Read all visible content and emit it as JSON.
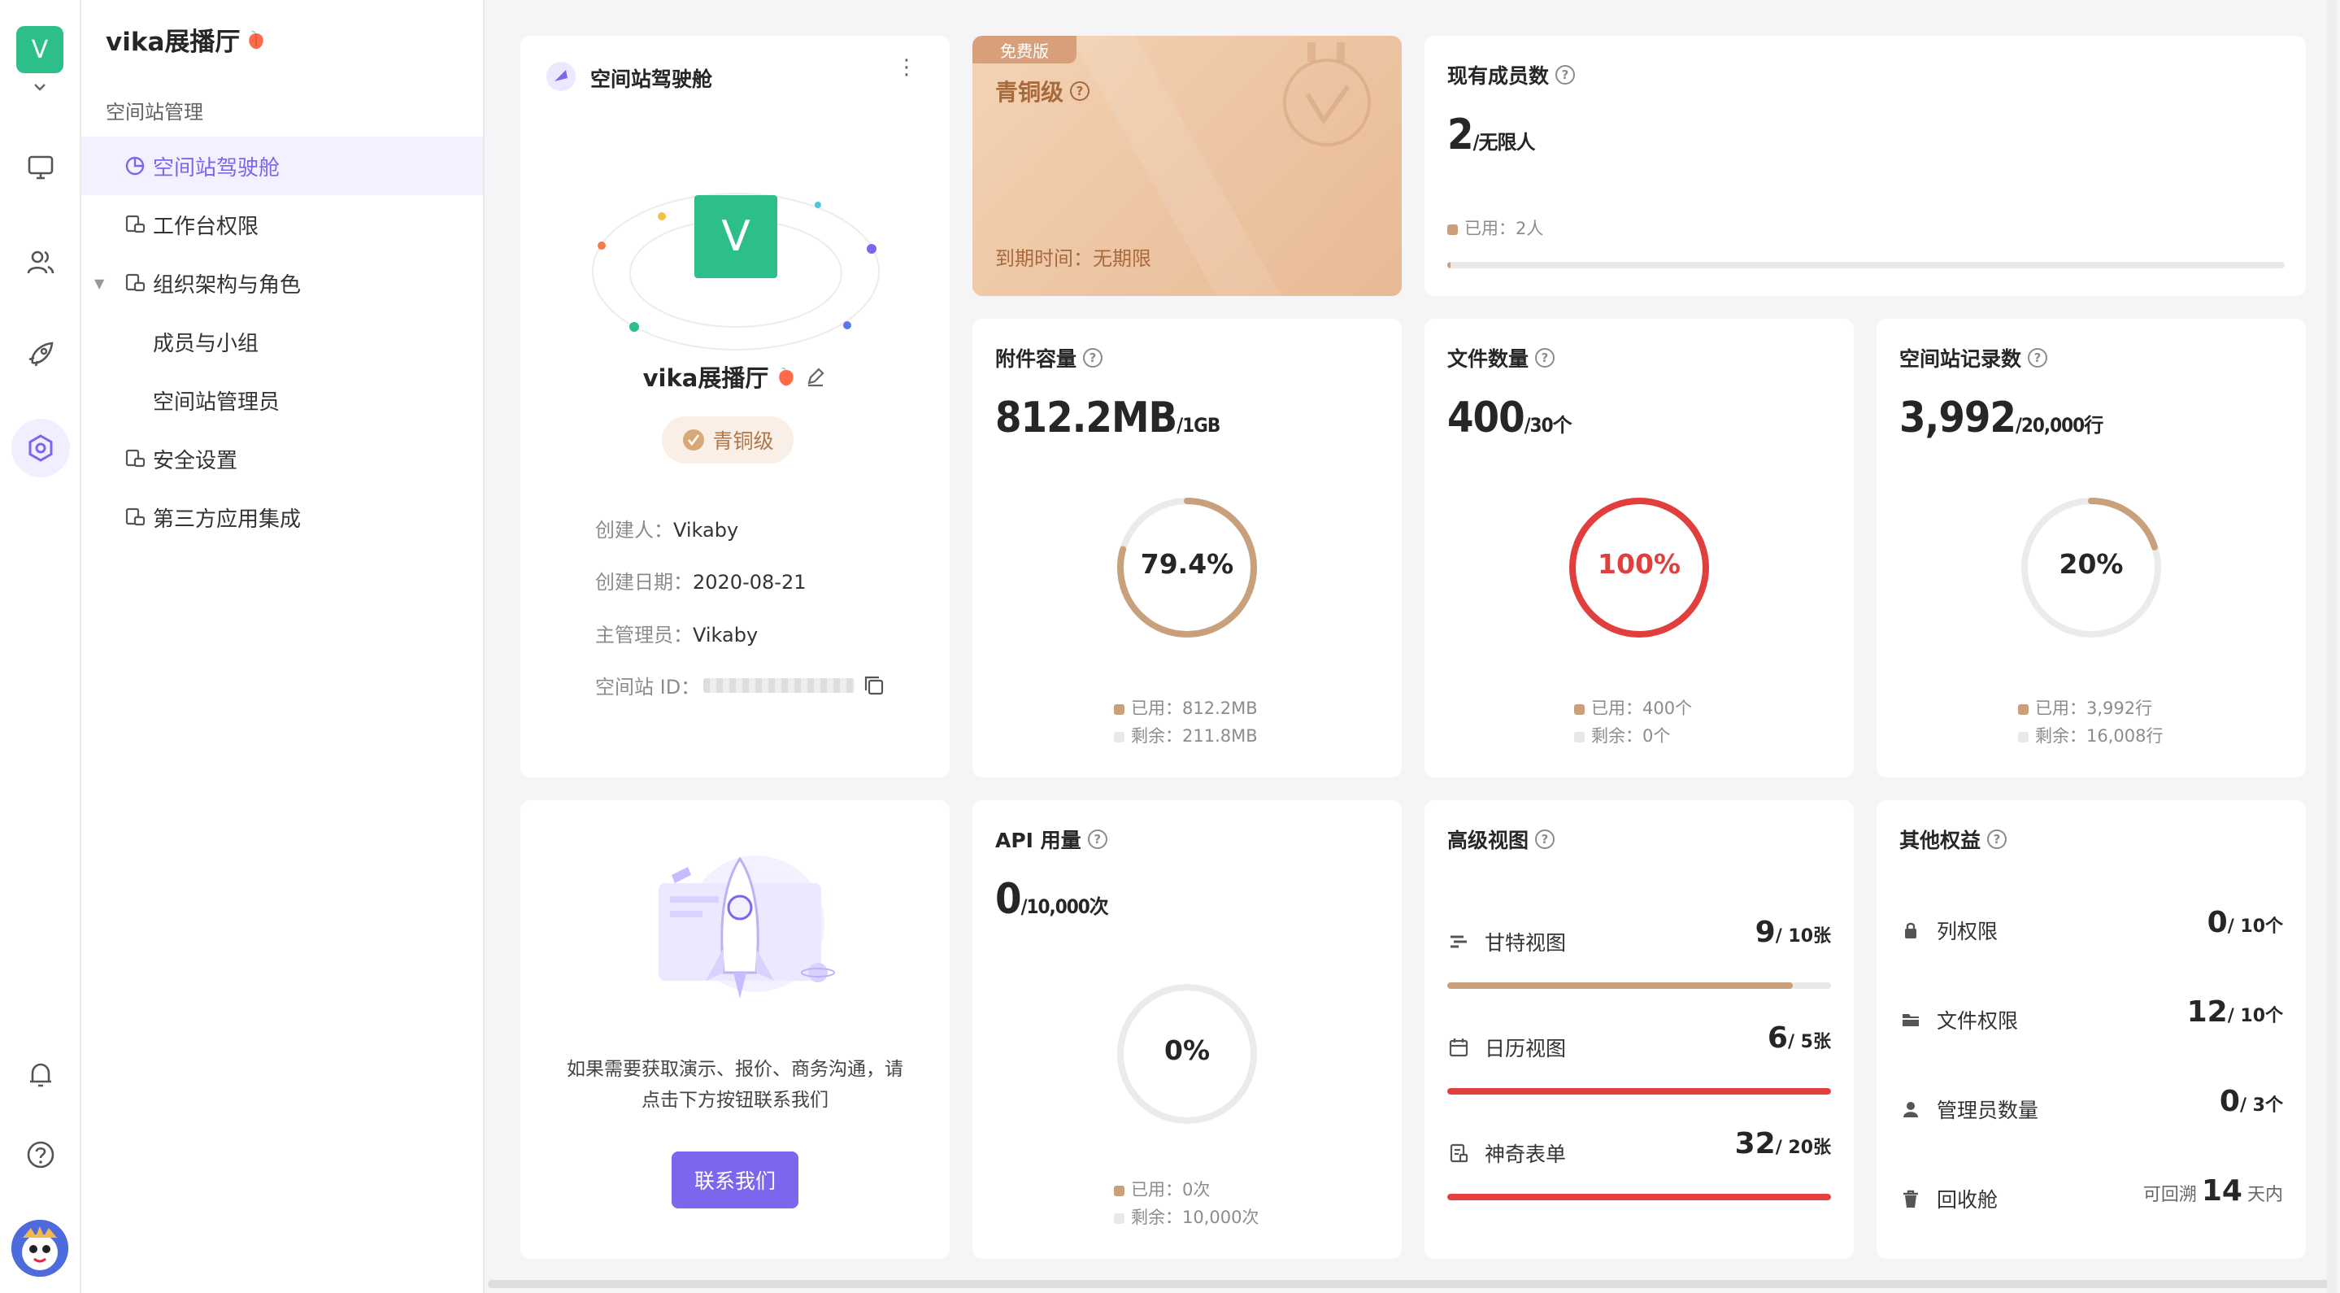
{
  "space": {
    "initial": "V",
    "name": "vika展播厅"
  },
  "sidebar": {
    "section": "空间站管理",
    "items": [
      {
        "label": "空间站驾驶舱"
      },
      {
        "label": "工作台权限"
      },
      {
        "label": "组织架构与角色"
      },
      {
        "label": "成员与小组"
      },
      {
        "label": "空间站管理员"
      },
      {
        "label": "安全设置"
      },
      {
        "label": "第三方应用集成"
      }
    ]
  },
  "cockpit": {
    "title": "空间站驾驶舱",
    "avatar_initial": "V",
    "name": "vika展播厅",
    "grade_badge": "青铜级",
    "creator_label": "创建人：",
    "creator": "Vikaby",
    "created_label": "创建日期：",
    "created": "2020-08-21",
    "admin_label": "主管理员：",
    "admin": "Vikaby",
    "id_label": "空间站 ID："
  },
  "plan": {
    "tag": "免费版",
    "grade": "青铜级",
    "expire": "到期时间：无期限"
  },
  "members": {
    "label": "现有成员数",
    "value": "2",
    "unit": "/无限人",
    "used": "已用：2人",
    "fraction": 0.002
  },
  "attachments": {
    "label": "附件容量",
    "value": "812.2MB",
    "unit": "/1GB",
    "percent": 79.4,
    "pct_label": "79.4%",
    "used": "已用：812.2MB",
    "remain": "剩余：211.8MB"
  },
  "files": {
    "label": "文件数量",
    "value": "400",
    "unit": "/30个",
    "percent": 100,
    "pct_label": "100%",
    "used": "已用：400个",
    "remain": "剩余：0个"
  },
  "records": {
    "label": "空间站记录数",
    "value": "3,992",
    "unit": "/20,000行",
    "percent": 20,
    "pct_label": "20%",
    "used": "已用：3,992行",
    "remain": "剩余：16,008行"
  },
  "contact": {
    "text1": "如果需要获取演示、报价、商务沟通，请",
    "text2": "点击下方按钮联系我们",
    "button": "联系我们"
  },
  "api": {
    "label": "API 用量",
    "value": "0",
    "unit": "/10,000次",
    "percent": 0,
    "pct_label": "0%",
    "used": "已用：0次",
    "remain": "剩余：10,000次"
  },
  "views": {
    "label": "高级视图",
    "items": [
      {
        "name": "甘特视图",
        "value": "9",
        "unit": "/ 10张",
        "fraction": 0.9
      },
      {
        "name": "日历视图",
        "value": "6",
        "unit": "/ 5张",
        "fraction": 1.0
      },
      {
        "name": "神奇表单",
        "value": "32",
        "unit": "/ 20张",
        "fraction": 1.0
      }
    ]
  },
  "benefits": {
    "label": "其他权益",
    "items": [
      {
        "name": "列权限",
        "value": "0",
        "unit": "/ 10个"
      },
      {
        "name": "文件权限",
        "value": "12",
        "unit": "/ 10个"
      },
      {
        "name": "管理员数量",
        "value": "0",
        "unit": "/ 3个"
      },
      {
        "name": "回收舱",
        "prefix": "可回溯",
        "value": "14",
        "unit": "天内"
      }
    ]
  },
  "colors": {
    "accent": "#7b67ee",
    "bronze": "#c9a07c",
    "danger": "#e33e3e",
    "green": "#2cbf8a"
  }
}
